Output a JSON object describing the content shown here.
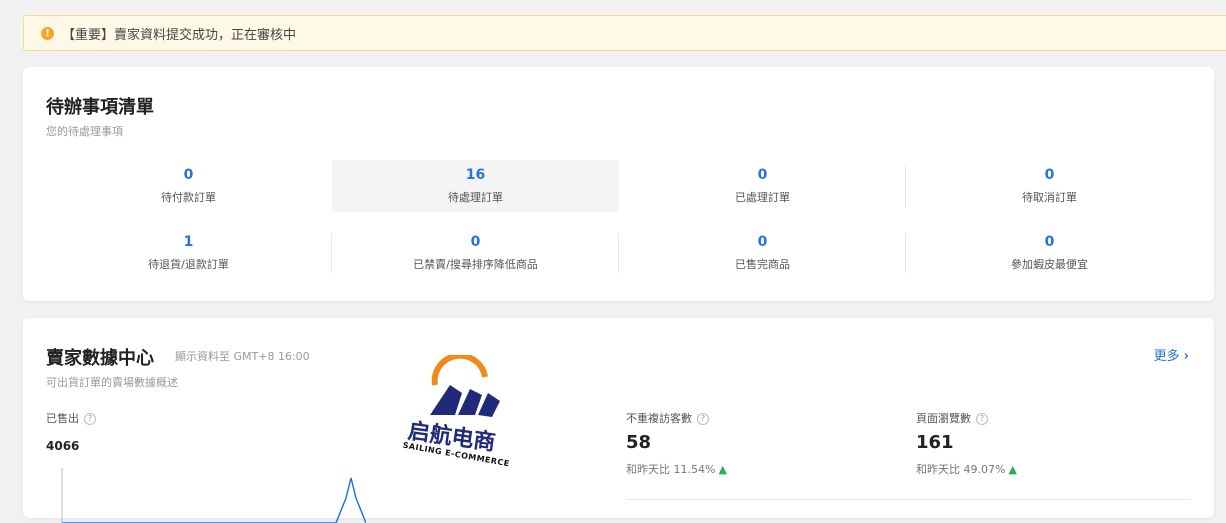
{
  "notice": {
    "text": "【重要】賣家資料提交成功，正在審核中",
    "icon": "exclamation-icon"
  },
  "todo": {
    "title": "待辦事項清單",
    "subtitle": "您的待處理事項",
    "items": [
      {
        "value": "0",
        "label": "待付款訂單"
      },
      {
        "value": "16",
        "label": "待處理訂單"
      },
      {
        "value": "0",
        "label": "已處理訂單"
      },
      {
        "value": "0",
        "label": "待取消訂單"
      },
      {
        "value": "1",
        "label": "待退貨/退款訂單"
      },
      {
        "value": "0",
        "label": "已禁賣/搜尋排序降低商品"
      },
      {
        "value": "0",
        "label": "已售完商品"
      },
      {
        "value": "0",
        "label": "參加蝦皮最便宜"
      }
    ]
  },
  "data_center": {
    "title": "賣家數據中心",
    "time_note": "顯示資料至 GMT+8 16:00",
    "subtitle": "可出貨訂單的賣場數據概述",
    "more": "更多",
    "sold": {
      "label": "已售出",
      "value": "4066"
    },
    "visitors": {
      "label": "不重複訪客數",
      "value": "58",
      "compare": "和昨天比 11.54%"
    },
    "pageviews": {
      "label": "頁面瀏覽數",
      "value": "161",
      "compare": "和昨天比 49.07%"
    }
  },
  "watermark": {
    "text": "启航电商",
    "subtext": "SAILING E-COMMERCE"
  },
  "colors": {
    "accent": "#2673dd",
    "warning": "#f5a623",
    "up": "#27ae60"
  }
}
